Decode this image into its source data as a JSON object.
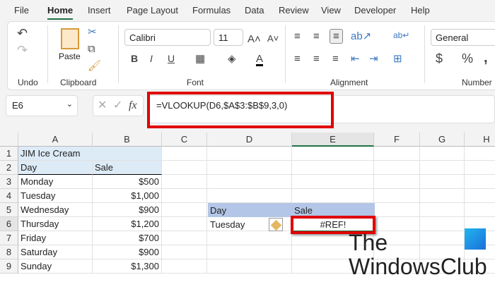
{
  "tabs": [
    "File",
    "Home",
    "Insert",
    "Page Layout",
    "Formulas",
    "Data",
    "Review",
    "View",
    "Developer",
    "Help"
  ],
  "active_tab": "Home",
  "ribbon": {
    "groups": [
      "Undo",
      "Clipboard",
      "Font",
      "Alignment",
      "Number"
    ],
    "paste_label": "Paste",
    "font_name": "Calibri",
    "font_size": "11",
    "number_format": "General"
  },
  "formula_bar": {
    "name_box": "E6",
    "formula": "=VLOOKUP(D6,$A$3:$B$9,3,0)",
    "fx": "fx"
  },
  "columns": [
    "A",
    "B",
    "C",
    "D",
    "E",
    "F",
    "G",
    "H"
  ],
  "rows": [
    "1",
    "2",
    "3",
    "4",
    "5",
    "6",
    "7",
    "8",
    "9"
  ],
  "sheet": {
    "title": "JIM Ice Cream",
    "headers": [
      "Day",
      "Sale"
    ],
    "data": [
      [
        "Monday",
        "$500"
      ],
      [
        "Tuesday",
        "$1,000"
      ],
      [
        "Wednesday",
        "$900"
      ],
      [
        "Thursday",
        "$1,200"
      ],
      [
        "Friday",
        "$700"
      ],
      [
        "Saturday",
        "$900"
      ],
      [
        "Sunday",
        "$1,300"
      ]
    ],
    "lookup_headers": [
      "Day",
      "Sale"
    ],
    "lookup_day": "Tuesday",
    "lookup_result": "#REF!"
  },
  "watermark": {
    "line1": "The",
    "line2": "WindowsClub"
  },
  "colors": {
    "accent": "#1e7145",
    "highlight": "#e00000",
    "table_header": "#b4c6e7",
    "title_fill": "#ddebf7"
  }
}
